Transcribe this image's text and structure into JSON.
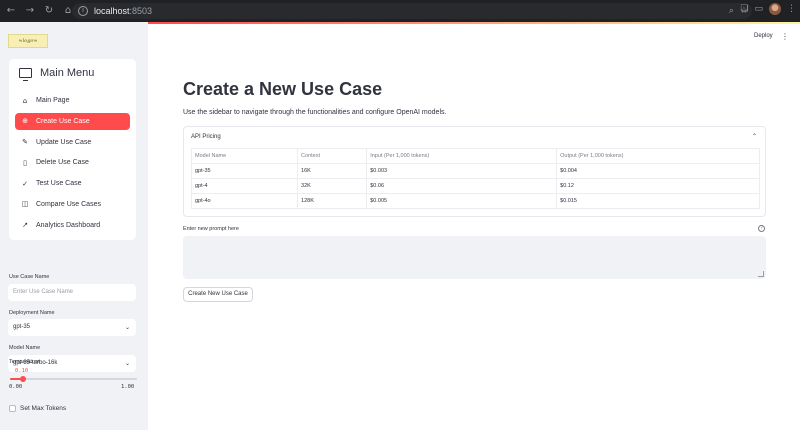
{
  "browser": {
    "url_host": "localhost",
    "url_port": ":8503"
  },
  "header": {
    "deploy_label": "Deploy"
  },
  "sidebar": {
    "menu_title": "Main Menu",
    "items": [
      {
        "label": "Main Page",
        "icon": "house-icon",
        "glyph": "⌂"
      },
      {
        "label": "Create Use Case",
        "icon": "plus-circle-icon",
        "glyph": "⊕"
      },
      {
        "label": "Update Use Case",
        "icon": "edit-icon",
        "glyph": "✎"
      },
      {
        "label": "Delete Use Case",
        "icon": "trash-icon",
        "glyph": "▯"
      },
      {
        "label": "Test Use Case",
        "icon": "check-circle-icon",
        "glyph": "✓"
      },
      {
        "label": "Compare Use Cases",
        "icon": "columns-icon",
        "glyph": "◫"
      },
      {
        "label": "Analytics Dashboard",
        "icon": "chart-icon",
        "glyph": "↗"
      }
    ],
    "active_index": 1,
    "use_case_name": {
      "label": "Use Case Name",
      "placeholder": "Enter Use Case Name"
    },
    "deployment_name": {
      "label": "Deployment Name",
      "value": "gpt-35"
    },
    "model_name": {
      "label": "Model Name",
      "value": "gpt-35-turbo-16k"
    },
    "temperature": {
      "label": "Temperature",
      "value": "0.10",
      "min": "0.00",
      "max": "1.00",
      "fraction": 0.1
    },
    "max_tokens": {
      "label": "Set Max Tokens",
      "checked": false
    }
  },
  "main": {
    "title": "Create a New Use Case",
    "subtitle": "Use the sidebar to navigate through the functionalities and configure OpenAI models.",
    "pricing": {
      "header": "API Pricing",
      "columns": [
        "Model Name",
        "Context",
        "Input (Per 1,000 tokens)",
        "Output (Per 1,000 tokens)"
      ],
      "rows": [
        [
          "gpt-35",
          "16K",
          "$0.003",
          "$0.004"
        ],
        [
          "gpt-4",
          "32K",
          "$0.06",
          "$0.12"
        ],
        [
          "gpt-4o",
          "128K",
          "$0.005",
          "$0.015"
        ]
      ]
    },
    "prompt": {
      "label": "Enter new prompt here",
      "value": ""
    },
    "create_button": "Create New Use Case"
  },
  "colors": {
    "accent": "#ff4b4b",
    "sidebar_bg": "#f0f2f6",
    "text": "#31333f"
  }
}
